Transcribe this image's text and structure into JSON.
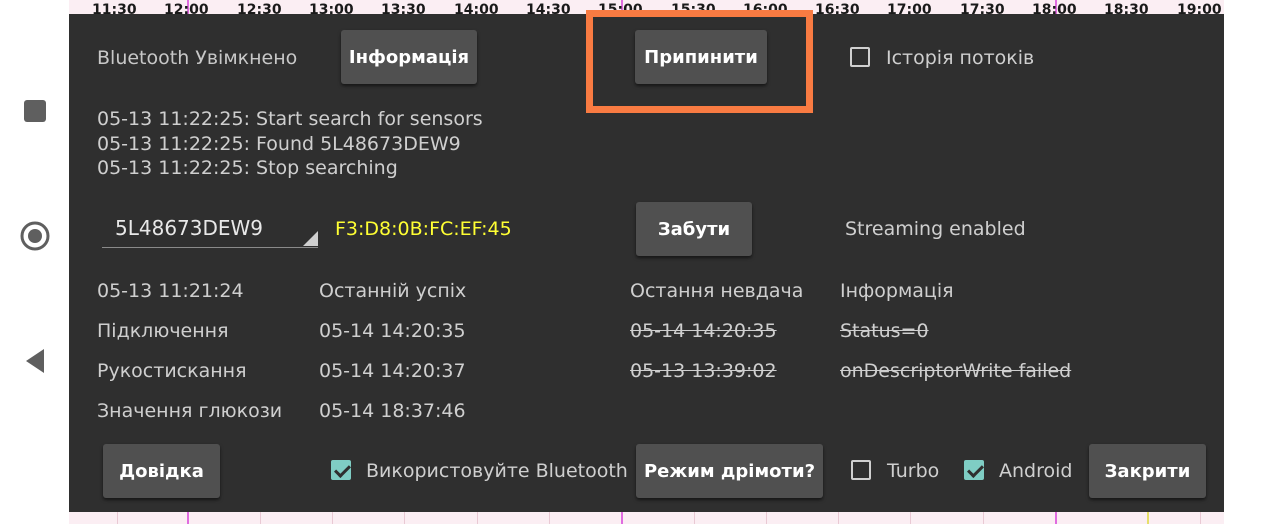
{
  "timeline": {
    "labels": [
      "11:30",
      "12:00",
      "12:30",
      "13:00",
      "13:30",
      "14:00",
      "14:30",
      "15:00",
      "15:30",
      "16:00",
      "16:30",
      "17:00",
      "17:30",
      "18:00",
      "18:30",
      "19:00"
    ]
  },
  "nav": {
    "icons": [
      "recent-apps-icon",
      "home-icon",
      "back-icon"
    ]
  },
  "header": {
    "bluetooth_status": "Bluetooth Увімкнено",
    "info_button": "Інформація",
    "stop_button": "Припинити",
    "stream_history_label": "Історія потоків",
    "stream_history_checked": false
  },
  "log": [
    "05-13 11:22:25: Start search for sensors",
    "05-13 11:22:25: Found 5L48673DEW9",
    "05-13 11:22:25: Stop searching"
  ],
  "device": {
    "selected_sensor": "5L48673DEW9",
    "mac_address": "F3:D8:0B:FC:EF:45",
    "mac_color": "#ffff33",
    "forget_button": "Забути",
    "streaming_status": "Streaming enabled"
  },
  "status_table": {
    "header": {
      "time": "05-13 11:21:24",
      "last_success": "Останній успіх",
      "last_failure": "Остання невдача",
      "info": "Інформація"
    },
    "rows": [
      {
        "label": "Підключення",
        "success": "05-14 14:20:35",
        "failure": "05-14 14:20:35",
        "info": "Status=0"
      },
      {
        "label": "Рукостискання",
        "success": "05-14 14:20:37",
        "failure": "05-13 13:39:02",
        "info": "onDescriptorWrite failed"
      },
      {
        "label": "Значення глюкози",
        "success": "05-14 18:37:46",
        "failure": "",
        "info": ""
      }
    ]
  },
  "footer": {
    "help_button": "Довідка",
    "use_bluetooth_label": "Використовуйте Bluetooth",
    "use_bluetooth_checked": true,
    "doze_button": "Режим дрімоти?",
    "turbo_label": "Turbo",
    "turbo_checked": false,
    "android_label": "Android",
    "android_checked": true,
    "close_button": "Закрити"
  },
  "colors": {
    "dialog_bg": "#2f2f2f",
    "button_bg": "#505050",
    "checkbox_accent": "#7fcdc4",
    "highlight": "#f97b42"
  }
}
